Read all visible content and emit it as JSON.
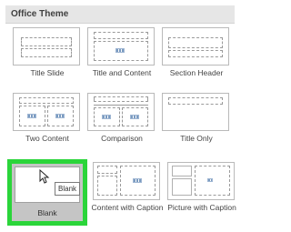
{
  "header": {
    "title": "Office Theme"
  },
  "layouts": [
    {
      "label": "Title Slide"
    },
    {
      "label": "Title and Content"
    },
    {
      "label": "Section Header"
    },
    {
      "label": "Two Content"
    },
    {
      "label": "Comparison"
    },
    {
      "label": "Title Only"
    },
    {
      "label": "Blank",
      "selected": true
    },
    {
      "label": "Content with Caption"
    },
    {
      "label": "Picture with Caption"
    }
  ],
  "tooltip": {
    "text": "Blank"
  },
  "colors": {
    "selection": "#2bd53a",
    "header_bg": "#e6e6e6"
  }
}
